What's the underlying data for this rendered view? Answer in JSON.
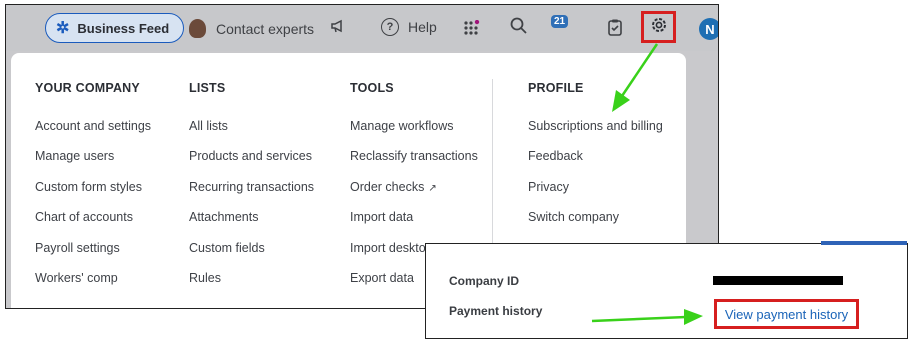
{
  "topbar": {
    "business_feed": "Business Feed",
    "contact_experts": "Contact experts",
    "help": "Help",
    "notifications_count": "21",
    "user_initial": "N"
  },
  "menu": {
    "your_company": {
      "heading": "YOUR COMPANY",
      "items": [
        "Account and settings",
        "Manage users",
        "Custom form styles",
        "Chart of accounts",
        "Payroll settings",
        "Workers' comp"
      ]
    },
    "lists": {
      "heading": "LISTS",
      "items": [
        "All lists",
        "Products and services",
        "Recurring transactions",
        "Attachments",
        "Custom fields",
        "Rules"
      ]
    },
    "tools": {
      "heading": "TOOLS",
      "items": [
        "Manage workflows",
        "Reclassify transactions",
        "Order checks",
        "Import data",
        "Import deskto",
        "Export data"
      ]
    },
    "profile": {
      "heading": "PROFILE",
      "items": [
        "Subscriptions and billing",
        "Feedback",
        "Privacy",
        "Switch company"
      ]
    }
  },
  "inset": {
    "company_id_label": "Company ID",
    "payment_history_label": "Payment history",
    "view_payment_history": "View payment history"
  },
  "colors": {
    "highlight_red": "#d61f1f",
    "arrow_green": "#39d11a",
    "link_blue": "#1a64b8"
  }
}
